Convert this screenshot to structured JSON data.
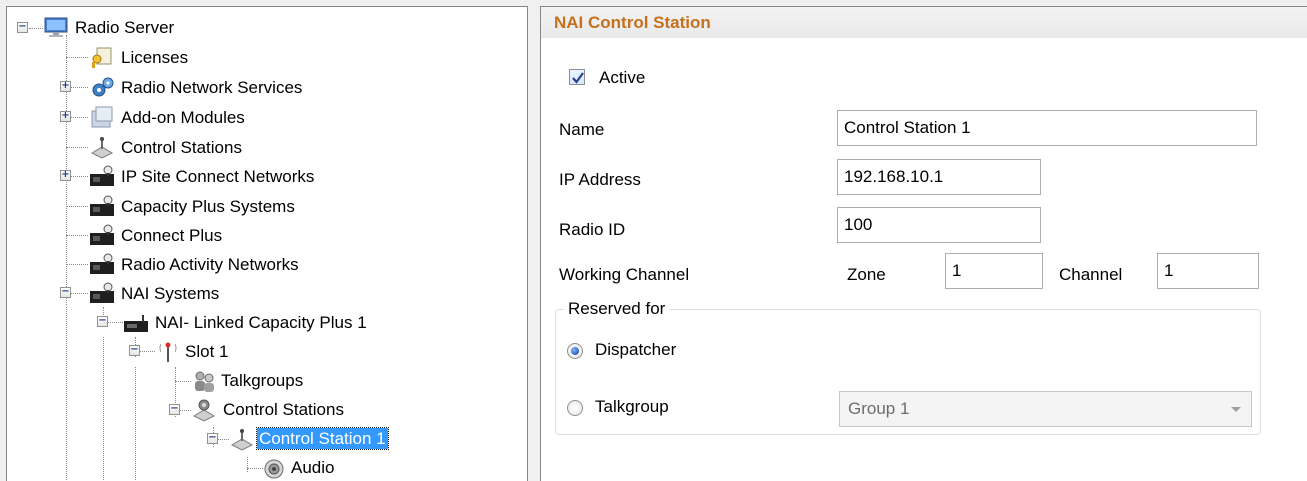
{
  "tree": {
    "nodes": {
      "radio_server": "Radio Server",
      "licenses": "Licenses",
      "radio_network_services": "Radio Network Services",
      "addon_modules": "Add-on Modules",
      "control_stations": "Control Stations",
      "ip_site_connect": "IP Site Connect Networks",
      "capacity_plus": "Capacity Plus Systems",
      "connect_plus": "Connect Plus",
      "radio_activity": "Radio Activity Networks",
      "nai_systems": "NAI Systems",
      "nai_linked": "NAI- Linked Capacity Plus 1",
      "slot1": "Slot 1",
      "talkgroups": "Talkgroups",
      "slot_control_stations": "Control Stations",
      "control_station_1": "Control Station 1",
      "audio": "Audio"
    },
    "expander_plus": "+",
    "expander_minus": "−"
  },
  "form": {
    "title": "NAI Control Station",
    "active_label": "Active",
    "active_checked": true,
    "name_label": "Name",
    "name_value": "Control Station 1",
    "ip_label": "IP Address",
    "ip_value": "192.168.10.1",
    "radio_id_label": "Radio ID",
    "radio_id_value": "100",
    "working_channel_label": "Working Channel",
    "zone_label": "Zone",
    "zone_value": "1",
    "channel_label": "Channel",
    "channel_value": "1",
    "reserved_for_label": "Reserved for",
    "dispatcher_label": "Dispatcher",
    "talkgroup_label": "Talkgroup",
    "reserved_selected": "Dispatcher",
    "talkgroup_select_value": "Group 1"
  },
  "colors": {
    "title": "#c5701d",
    "selection": "#3399ff"
  }
}
